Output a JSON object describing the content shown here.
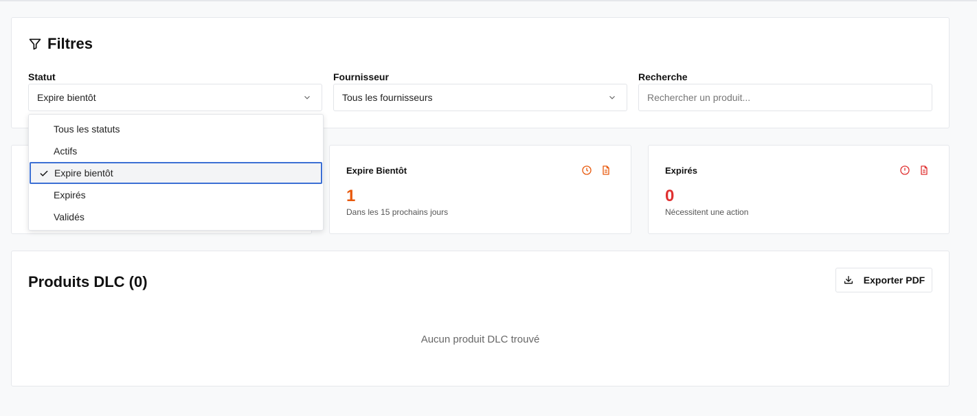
{
  "filters": {
    "title": "Filtres",
    "statut": {
      "label": "Statut",
      "value": "Expire bientôt"
    },
    "fournisseur": {
      "label": "Fournisseur",
      "value": "Tous les fournisseurs"
    },
    "recherche": {
      "label": "Recherche",
      "placeholder": "Rechercher un produit..."
    }
  },
  "dropdown": {
    "items": [
      "Tous les statuts",
      "Actifs",
      "Expire bientôt",
      "Expirés",
      "Validés"
    ],
    "selected": "Expire bientôt"
  },
  "stats": {
    "soon": {
      "title": "Expire Bientôt",
      "value": "1",
      "sub": "Dans les 15 prochains jours",
      "color": "#e8590c"
    },
    "expired": {
      "title": "Expirés",
      "value": "0",
      "sub": "Nécessitent une action",
      "color": "#e03131"
    }
  },
  "products": {
    "title": "Produits DLC (0)",
    "export_label": "Exporter PDF",
    "empty": "Aucun produit DLC trouvé"
  },
  "colors": {
    "accent": "#3b6fd4",
    "orange": "#e8590c",
    "red": "#e03131"
  }
}
